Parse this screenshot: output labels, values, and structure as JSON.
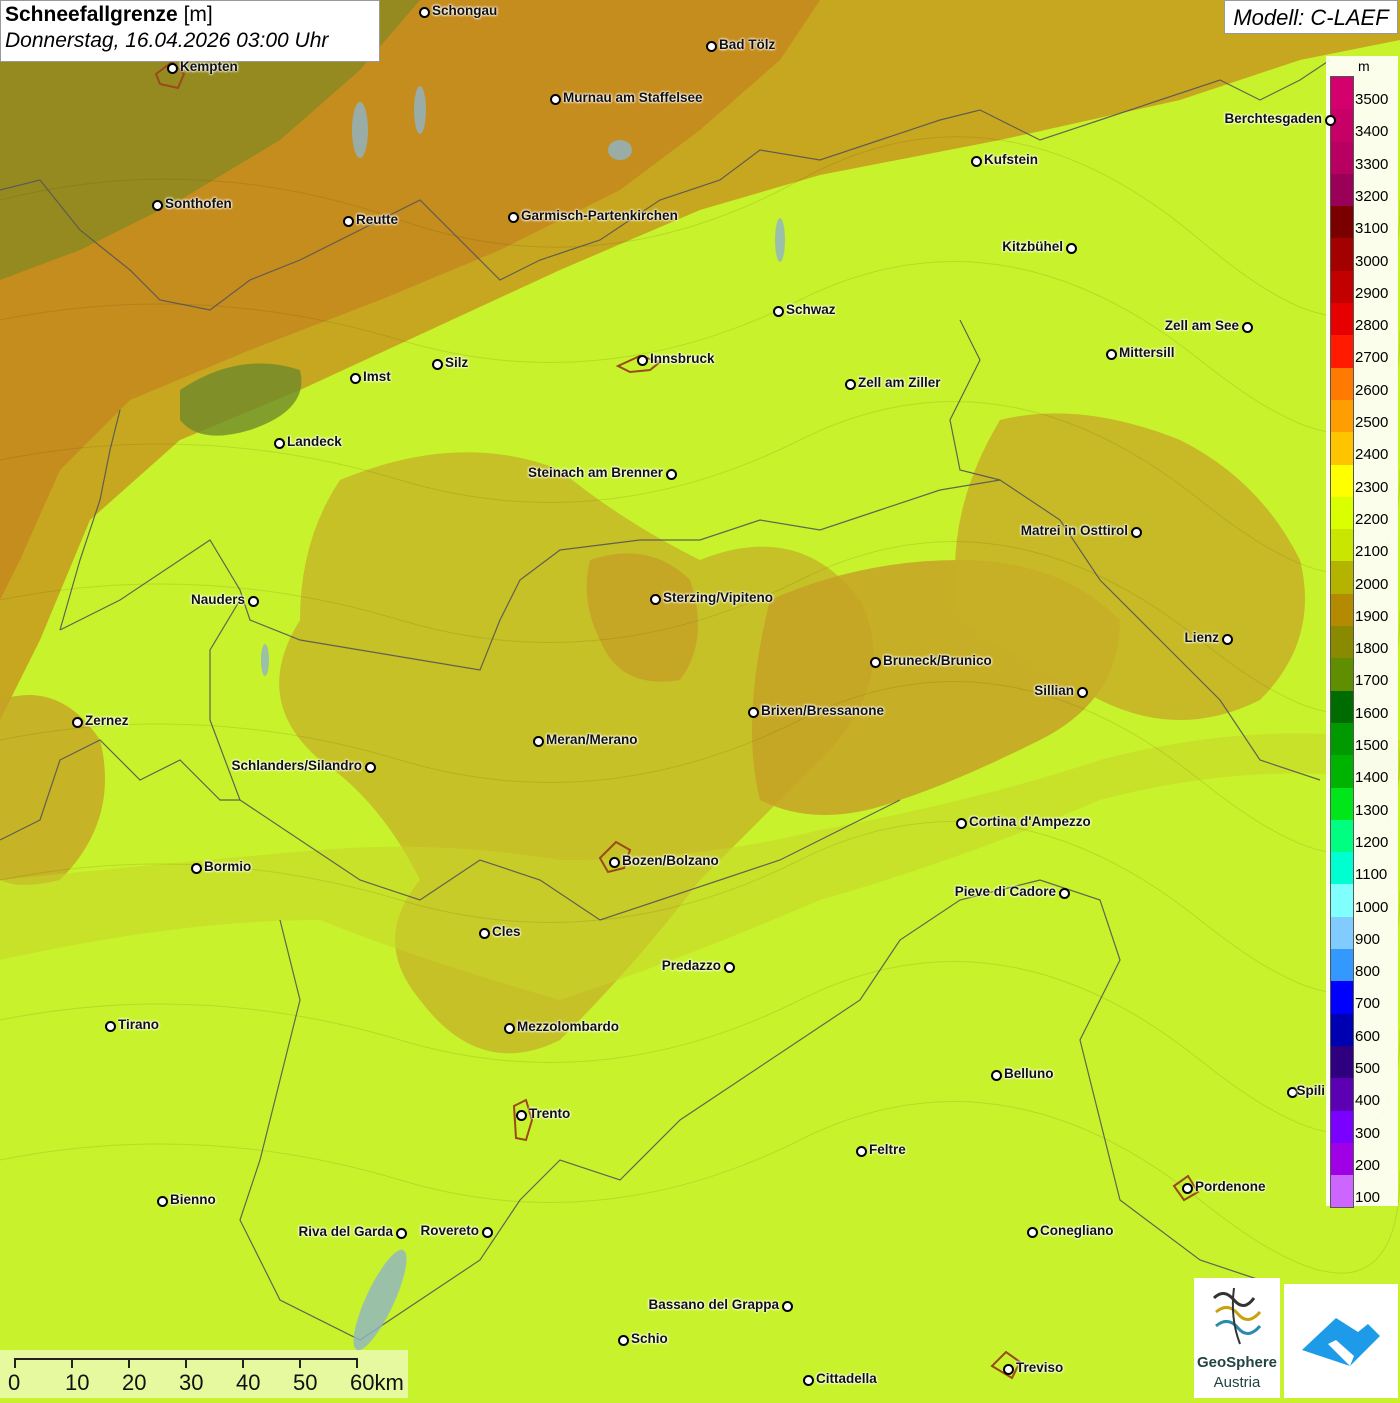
{
  "header": {
    "title_bold": "Schneefallgrenze",
    "title_unit": "[m]",
    "datetime": "Donnerstag, 16.04.2026 03:00 Uhr",
    "model": "Modell: C-LAEF"
  },
  "legend": {
    "unit": "m",
    "levels": [
      {
        "label": "3500",
        "color": "#d4006e"
      },
      {
        "label": "3400",
        "color": "#c70068"
      },
      {
        "label": "3300",
        "color": "#b80062"
      },
      {
        "label": "3200",
        "color": "#9a0058"
      },
      {
        "label": "3100",
        "color": "#7a0000"
      },
      {
        "label": "3000",
        "color": "#a30000"
      },
      {
        "label": "2900",
        "color": "#c20000"
      },
      {
        "label": "2800",
        "color": "#e60000"
      },
      {
        "label": "2700",
        "color": "#ff1a00"
      },
      {
        "label": "2600",
        "color": "#ff7a00"
      },
      {
        "label": "2500",
        "color": "#ff9e00"
      },
      {
        "label": "2400",
        "color": "#ffc400"
      },
      {
        "label": "2300",
        "color": "#ffff00"
      },
      {
        "label": "2200",
        "color": "#d9ff00"
      },
      {
        "label": "2100",
        "color": "#c8e600"
      },
      {
        "label": "2000",
        "color": "#b3b300"
      },
      {
        "label": "1900",
        "color": "#b38a00"
      },
      {
        "label": "1800",
        "color": "#8a8a00"
      },
      {
        "label": "1700",
        "color": "#5f8f00"
      },
      {
        "label": "1600",
        "color": "#006b00"
      },
      {
        "label": "1500",
        "color": "#009900"
      },
      {
        "label": "1400",
        "color": "#00b300"
      },
      {
        "label": "1300",
        "color": "#00e61a"
      },
      {
        "label": "1200",
        "color": "#00ff80"
      },
      {
        "label": "1100",
        "color": "#00ffd0"
      },
      {
        "label": "1000",
        "color": "#80ffff"
      },
      {
        "label": "900",
        "color": "#80ccff"
      },
      {
        "label": "800",
        "color": "#3399ff"
      },
      {
        "label": "700",
        "color": "#0000ff"
      },
      {
        "label": "600",
        "color": "#0000b3"
      },
      {
        "label": "500",
        "color": "#2e0080"
      },
      {
        "label": "400",
        "color": "#5c00b3"
      },
      {
        "label": "300",
        "color": "#7a00ff"
      },
      {
        "label": "200",
        "color": "#a000e6"
      },
      {
        "label": "100",
        "color": "#cc66ff"
      }
    ]
  },
  "scale_bar": {
    "labels": [
      "0",
      "10",
      "20",
      "30",
      "40",
      "50",
      "60km"
    ]
  },
  "logo": {
    "line1": "GeoSphere",
    "line2": "Austria"
  },
  "cities": [
    {
      "name": "Schongau",
      "side": "right"
    },
    {
      "name": "Bad Tölz",
      "side": "right"
    },
    {
      "name": "Kempten",
      "side": "right"
    },
    {
      "name": "Murnau am Staffelsee",
      "side": "right"
    },
    {
      "name": "Berchtesgaden",
      "side": "left"
    },
    {
      "name": "Kufstein",
      "side": "right"
    },
    {
      "name": "Sonthofen",
      "side": "right"
    },
    {
      "name": "Reutte",
      "side": "right"
    },
    {
      "name": "Garmisch-Partenkirchen",
      "side": "right"
    },
    {
      "name": "Kitzbühel",
      "side": "left"
    },
    {
      "name": "Schwaz",
      "side": "right"
    },
    {
      "name": "Zell am See",
      "side": "left"
    },
    {
      "name": "Mittersill",
      "side": "right"
    },
    {
      "name": "Innsbruck",
      "side": "right"
    },
    {
      "name": "Silz",
      "side": "right"
    },
    {
      "name": "Imst",
      "side": "right"
    },
    {
      "name": "Zell am Ziller",
      "side": "right"
    },
    {
      "name": "Landeck",
      "side": "right"
    },
    {
      "name": "Steinach am Brenner",
      "side": "left"
    },
    {
      "name": "Matrei in Osttirol",
      "side": "left"
    },
    {
      "name": "Nauders",
      "side": "left"
    },
    {
      "name": "Sterzing/Vipiteno",
      "side": "right"
    },
    {
      "name": "Lienz",
      "side": "left"
    },
    {
      "name": "Bruneck/Brunico",
      "side": "right"
    },
    {
      "name": "Sillian",
      "side": "left"
    },
    {
      "name": "Zernez",
      "side": "right"
    },
    {
      "name": "Brixen/Bressanone",
      "side": "right"
    },
    {
      "name": "Meran/Merano",
      "side": "right"
    },
    {
      "name": "Schlanders/Silandro",
      "side": "left"
    },
    {
      "name": "Cortina d'Ampezzo",
      "side": "right"
    },
    {
      "name": "Bozen/Bolzano",
      "side": "right"
    },
    {
      "name": "Bormio",
      "side": "right"
    },
    {
      "name": "Pieve di Cadore",
      "side": "left"
    },
    {
      "name": "Cles",
      "side": "right"
    },
    {
      "name": "Predazzo",
      "side": "left"
    },
    {
      "name": "Tirano",
      "side": "right"
    },
    {
      "name": "Mezzolombardo",
      "side": "right"
    },
    {
      "name": "Belluno",
      "side": "right"
    },
    {
      "name": "Spili",
      "side": "right"
    },
    {
      "name": "Trento",
      "side": "right"
    },
    {
      "name": "Feltre",
      "side": "right"
    },
    {
      "name": "Bienno",
      "side": "right"
    },
    {
      "name": "Pordenone",
      "side": "right"
    },
    {
      "name": "Riva del Garda",
      "side": "left"
    },
    {
      "name": "Rovereto",
      "side": "left"
    },
    {
      "name": "Conegliano",
      "side": "right"
    },
    {
      "name": "Bassano del Grappa",
      "side": "left"
    },
    {
      "name": "Schio",
      "side": "right"
    },
    {
      "name": "Treviso",
      "side": "right"
    },
    {
      "name": "Cittadella",
      "side": "right"
    }
  ]
}
